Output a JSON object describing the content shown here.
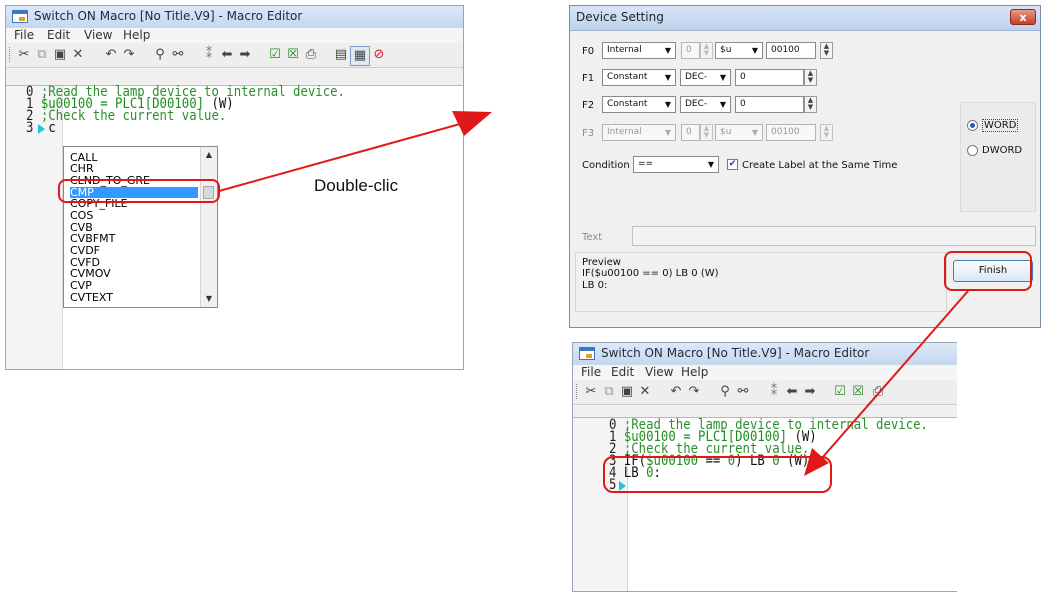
{
  "left_editor": {
    "title": "Switch ON Macro [No Title.V9] - Macro Editor",
    "menu": [
      "File",
      "Edit",
      "View",
      "Help"
    ],
    "toolbar_icons": [
      "cut-icon",
      "copy-icon",
      "paste-icon",
      "delete-icon",
      "undo-icon",
      "redo-icon",
      "find-icon",
      "replace-icon",
      "bookmark-icon",
      "back-icon",
      "forward-icon",
      "check-icon",
      "check-all-icon",
      "print-icon",
      "register-icon",
      "view-number-icon",
      "stop-icon"
    ],
    "lines": [
      {
        "num": "0",
        "text": ";Read the lamp device to internal device."
      },
      {
        "num": "1",
        "green": "$u00100 = PLC1[D00100]",
        "suffix": " (W)"
      },
      {
        "num": "2",
        "text": ";Check the current value."
      },
      {
        "num": "3",
        "text": "c"
      }
    ],
    "autocomplete": {
      "items": [
        "CALL",
        "CHR",
        "CLND_TO_GRE",
        "CMP",
        "COPY_FILE",
        "COS",
        "CVB",
        "CVBFMT",
        "CVDF",
        "CVFD",
        "CVMOV",
        "CVP",
        "CVTEXT"
      ],
      "selected": "CMP"
    }
  },
  "annotation": {
    "double_click": "Double-clic"
  },
  "dialog": {
    "title": "Device Setting",
    "close": "x",
    "rows": [
      {
        "label": "F0",
        "type": "Internal",
        "format": "0",
        "prefix": "$u",
        "value": "00100",
        "enabled": true
      },
      {
        "label": "F1",
        "type": "Constant",
        "format": "DEC-",
        "value": "0",
        "enabled": true
      },
      {
        "label": "F2",
        "type": "Constant",
        "format": "DEC-",
        "value": "0",
        "enabled": true
      },
      {
        "label": "F3",
        "type": "Internal",
        "format": "0",
        "prefix": "$u",
        "value": "00100",
        "enabled": false
      }
    ],
    "condition_label": "Condition",
    "condition_value": "==",
    "create_label": "Create Label at the Same Time",
    "create_label_checked": true,
    "word_options": [
      "WORD",
      "DWORD"
    ],
    "word_selected": "WORD",
    "text_label": "Text",
    "preview_label": "Preview",
    "preview_lines": [
      "IF($u00100 == 0) LB 0 (W)",
      "LB 0:"
    ],
    "finish": "Finish"
  },
  "right_editor": {
    "title": "Switch ON Macro [No Title.V9] - Macro Editor",
    "menu": [
      "File",
      "Edit",
      "View",
      "Help"
    ],
    "lines": [
      {
        "num": "0",
        "text": ";Read the lamp device to internal device."
      },
      {
        "num": "1",
        "green": "$u00100 = PLC1[D00100]",
        "suffix": " (W)"
      },
      {
        "num": "2",
        "text": ";Check the current value."
      },
      {
        "num": "3",
        "pre": "IF(",
        "green1": "$u00100",
        "mid": " == ",
        "green2": "0",
        "post": ") LB ",
        "green3": "0",
        "tail": " (W)"
      },
      {
        "num": "4",
        "pre": "LB ",
        "green1": "0",
        "tail": ":"
      },
      {
        "num": "5",
        "text": ""
      }
    ]
  },
  "colors": {
    "annotation_red": "#e01818",
    "comment_green": "#2c8f2c",
    "selection_blue": "#3399ff"
  }
}
